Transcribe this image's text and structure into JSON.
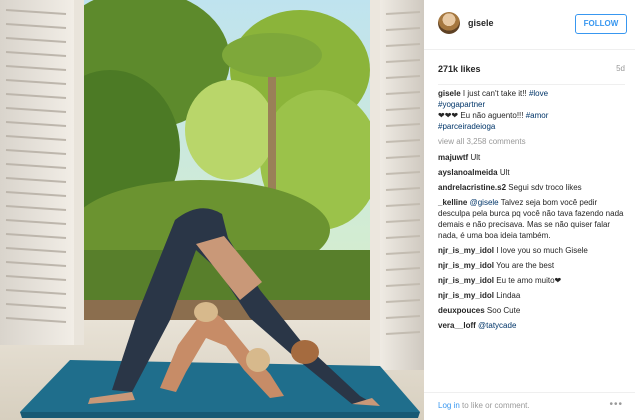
{
  "post": {
    "username": "gisele",
    "follow_label": "FOLLOW",
    "likes": "271k likes",
    "age": "5d"
  },
  "caption": {
    "user": "gisele",
    "text1": "I just can't take it!!",
    "tag1": "#love",
    "tag2": "#yogapartner",
    "text2": "❤❤❤ Eu não aguento!!!",
    "tag3": "#amor",
    "tag4": "#parceiradeioga"
  },
  "view_all": "view all 3,258 comments",
  "comments": [
    {
      "user": "majuwtf",
      "text": "Ult"
    },
    {
      "user": "ayslanoalmeida",
      "text": "Ult"
    },
    {
      "user": "andrelacristine.s2",
      "text": "Segui sdv troco likes"
    },
    {
      "user": "_kelline",
      "mention": "@gisele",
      "text": "Talvez seja bom você pedir desculpa pela burca pq você não tava fazendo nada demais e não precisava. Mas se não quiser falar nada, é uma boa ideia também."
    },
    {
      "user": "njr_is_my_idol",
      "text": "I love you so much Gisele"
    },
    {
      "user": "njr_is_my_idol",
      "text": "You are the best"
    },
    {
      "user": "njr_is_my_idol",
      "text": "Eu te amo muito❤"
    },
    {
      "user": "njr_is_my_idol",
      "text": "Lindaa"
    },
    {
      "user": "deuxpouces",
      "text": "Soo Cute"
    },
    {
      "user": "vera__loff",
      "mention": "@tatycade",
      "text": ""
    }
  ],
  "footer": {
    "login_link": "Log in",
    "login_text": "to like or comment.",
    "more_icon": "more-dots-icon"
  },
  "colors": {
    "accent": "#3897f0",
    "hashtag": "#003569",
    "mat": "#1f6e8c"
  }
}
